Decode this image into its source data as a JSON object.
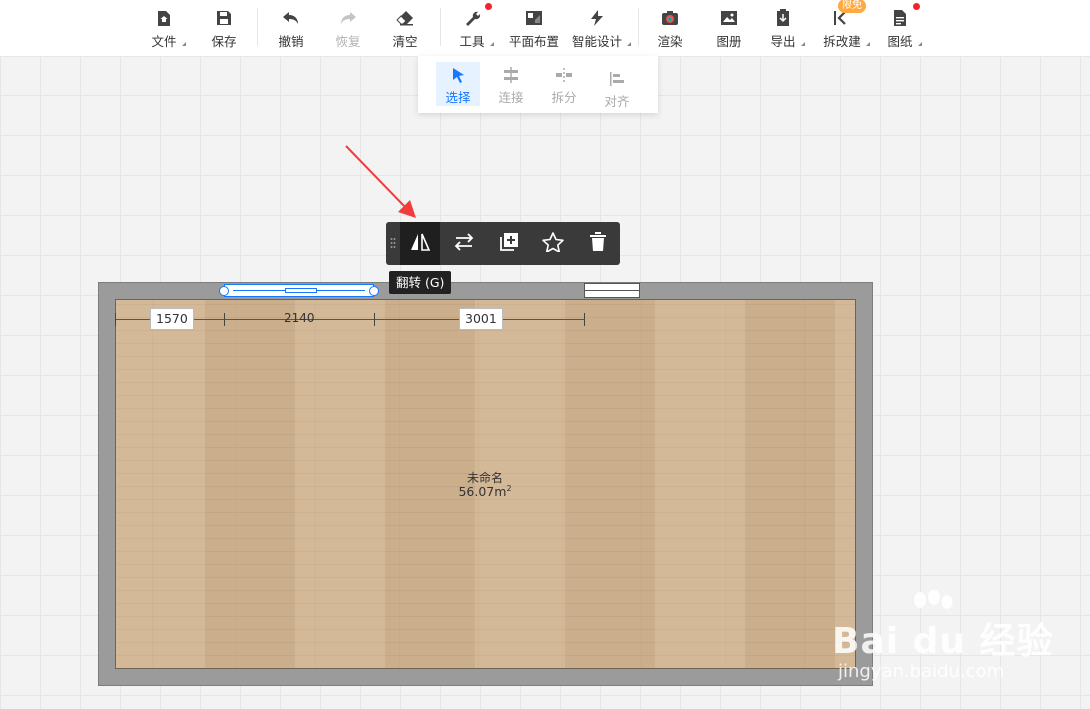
{
  "toolbar": {
    "items": [
      {
        "label": "文件",
        "icon": "file-home-icon"
      },
      {
        "label": "保存",
        "icon": "save-icon"
      },
      {
        "label": "撤销",
        "icon": "undo-icon"
      },
      {
        "label": "恢复",
        "icon": "redo-icon"
      },
      {
        "label": "清空",
        "icon": "eraser-icon"
      },
      {
        "label": "工具",
        "icon": "wrench-icon"
      },
      {
        "label": "平面布置",
        "icon": "floor-layout-icon"
      },
      {
        "label": "智能设计",
        "icon": "lightning-icon"
      },
      {
        "label": "渲染",
        "icon": "render-camera-icon"
      },
      {
        "label": "图册",
        "icon": "album-icon"
      },
      {
        "label": "导出",
        "icon": "export-icon"
      },
      {
        "label": "拆改建",
        "icon": "renovate-icon"
      },
      {
        "label": "图纸",
        "icon": "drawing-icon"
      }
    ],
    "badge": "限免"
  },
  "tools_menu": {
    "items": [
      {
        "label": "选择",
        "icon": "select-cursor-icon",
        "active": true
      },
      {
        "label": "连接",
        "icon": "connect-icon"
      },
      {
        "label": "拆分",
        "icon": "split-icon"
      },
      {
        "label": "对齐",
        "icon": "align-icon"
      }
    ]
  },
  "context_toolbar": {
    "buttons": [
      "flip-icon",
      "swap-icon",
      "duplicate-icon",
      "favorite-star-icon",
      "delete-trash-icon"
    ],
    "tooltip": "翻转 (G)"
  },
  "dimensions": {
    "seg1": "1570",
    "seg2": "2140",
    "seg3": "3001"
  },
  "room": {
    "name": "未命名",
    "area": "56.07m",
    "area_sup": "2"
  },
  "watermark": {
    "brand": "Bai du 经验",
    "url": "jingyan.baidu.com"
  },
  "colors": {
    "accent": "#1677ff",
    "floor": "#d2b592",
    "wall": "#9b9b9b",
    "annotation_arrow": "#f03c3c"
  }
}
